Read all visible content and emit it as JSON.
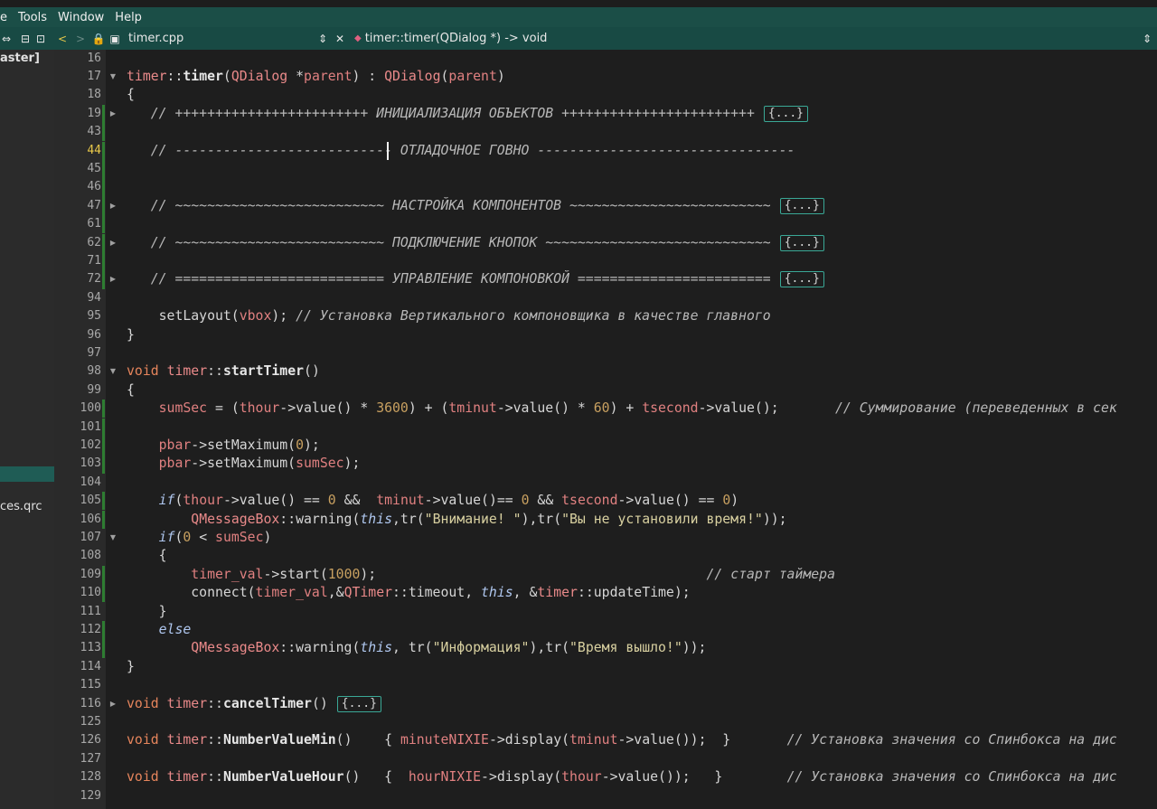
{
  "menu": [
    "e",
    "Tools",
    "Window",
    "Help"
  ],
  "toolbar": {
    "file_name": "timer.cpp",
    "symbol": "timer::timer(QDialog *) -> void"
  },
  "sidebar": {
    "branch": "aster]",
    "resource": "ces.qrc"
  },
  "lines": [
    {
      "n": "16",
      "c": ""
    },
    {
      "n": "17",
      "c": "<span class='cls'>timer</span>::<span class='fn'>timer</span>(<span class='cls'>QDialog</span> *<span class='var'>parent</span>) : <span class='cls'>QDialog</span>(<span class='var'>parent</span>)"
    },
    {
      "n": "18",
      "c": "{"
    },
    {
      "n": "19",
      "c": "   <span class='cm'>// ++++++++++++++++++++++++ ИНИЦИАЛИЗАЦИЯ ОБЪЕКТОВ ++++++++++++++++++++++++</span><span class='foldbox'>{...}</span>"
    },
    {
      "n": "43",
      "c": ""
    },
    {
      "n": "44",
      "c": "   <span class='cm'>// --------------------------- ОТЛАДОЧНОЕ ГОВНО --------------------------------</span>"
    },
    {
      "n": "45",
      "c": ""
    },
    {
      "n": "46",
      "c": ""
    },
    {
      "n": "47",
      "c": "   <span class='cm'>// ~~~~~~~~~~~~~~~~~~~~~~~~~~ НАСТРОЙКА КОМПОНЕНТОВ ~~~~~~~~~~~~~~~~~~~~~~~~~</span><span class='foldbox'>{...}</span>"
    },
    {
      "n": "61",
      "c": ""
    },
    {
      "n": "62",
      "c": "   <span class='cm'>// ~~~~~~~~~~~~~~~~~~~~~~~~~~ ПОДКЛЮЧЕНИЕ КНОПОК ~~~~~~~~~~~~~~~~~~~~~~~~~~~~</span><span class='foldbox'>{...}</span>"
    },
    {
      "n": "71",
      "c": ""
    },
    {
      "n": "72",
      "c": "   <span class='cm'>// ========================== УПРАВЛЕНИЕ КОМПОНОВКОЙ ========================</span><span class='foldbox'>{...}</span>"
    },
    {
      "n": "94",
      "c": ""
    },
    {
      "n": "95",
      "c": "    setLayout(<span class='var'>vbox</span>); <span class='cm'>// Установка Вертикального компоновщика в качестве главного</span>"
    },
    {
      "n": "96",
      "c": "}"
    },
    {
      "n": "97",
      "c": ""
    },
    {
      "n": "98",
      "c": "<span class='k'>void</span> <span class='cls'>timer</span>::<span class='fn'>startTimer</span>()"
    },
    {
      "n": "99",
      "c": "{"
    },
    {
      "n": "100",
      "c": "    <span class='var'>sumSec</span> = (<span class='var'>thour</span>->value() * <span class='num'>3600</span>) + (<span class='var'>tminut</span>->value() * <span class='num'>60</span>) + <span class='var'>tsecond</span>->value();       <span class='cm'>// Суммирование (переведенных в сек</span>"
    },
    {
      "n": "101",
      "c": ""
    },
    {
      "n": "102",
      "c": "    <span class='var'>pbar</span>->setMaximum(<span class='num'>0</span>);"
    },
    {
      "n": "103",
      "c": "    <span class='var'>pbar</span>->setMaximum(<span class='var'>sumSec</span>);"
    },
    {
      "n": "104",
      "c": ""
    },
    {
      "n": "105",
      "c": "    <span class='kw2'>if</span>(<span class='var'>thour</span>->value() == <span class='num'>0</span> &&  <span class='var'>tminut</span>->value()== <span class='num'>0</span> && <span class='var'>tsecond</span>->value() == <span class='num'>0</span>)"
    },
    {
      "n": "106",
      "c": "        <span class='cls'>QMessageBox</span>::warning(<span class='kw2'>this</span>,tr(<span class='str'>\"Внимание! \"</span>),tr(<span class='str'>\"Вы не установили время!\"</span>));"
    },
    {
      "n": "107",
      "c": "    <span class='kw2'>if</span>(<span class='num'>0</span> < <span class='var'>sumSec</span>)"
    },
    {
      "n": "108",
      "c": "    {"
    },
    {
      "n": "109",
      "c": "        <span class='var'>timer_val</span>->start(<span class='num'>1000</span>);                                         <span class='cm'>// старт таймера</span>"
    },
    {
      "n": "110",
      "c": "        connect(<span class='var'>timer_val</span>,&<span class='cls'>QTimer</span>::timeout, <span class='kw2'>this</span>, &<span class='cls'>timer</span>::updateTime);"
    },
    {
      "n": "111",
      "c": "    }"
    },
    {
      "n": "112",
      "c": "    <span class='kw2'>else</span>"
    },
    {
      "n": "113",
      "c": "        <span class='cls'>QMessageBox</span>::warning(<span class='kw2'>this</span>, tr(<span class='str'>\"Информация\"</span>),tr(<span class='str'>\"Время вышло!\"</span>));"
    },
    {
      "n": "114",
      "c": "}"
    },
    {
      "n": "115",
      "c": ""
    },
    {
      "n": "116",
      "c": "<span class='k'>void</span> <span class='cls'>timer</span>::<span class='fn'>cancelTimer</span>()<span class='foldbox'>{...}</span>"
    },
    {
      "n": "125",
      "c": ""
    },
    {
      "n": "126",
      "c": "<span class='k'>void</span> <span class='cls'>timer</span>::<span class='fn'>NumberValueMin</span>()    { <span class='var'>minuteNIXIE</span>->display(<span class='var'>tminut</span>->value());  }       <span class='cm'>// Установка значения со Спинбокса на дис</span>"
    },
    {
      "n": "127",
      "c": ""
    },
    {
      "n": "128",
      "c": "<span class='k'>void</span> <span class='cls'>timer</span>::<span class='fn'>NumberValueHour</span>()   {  <span class='var'>hourNIXIE</span>->display(<span class='var'>thour</span>->value());   }        <span class='cm'>// Установка значения со Спинбокса на дис</span>"
    },
    {
      "n": "129",
      "c": ""
    }
  ],
  "folded_lines": [
    "17",
    "19",
    "47",
    "62",
    "72",
    "98",
    "107",
    "116"
  ],
  "current_line": "44",
  "colors": {
    "accent": "#1b4e47",
    "fold_box": "#3aa896",
    "modified_marker": "#2e7d32"
  }
}
